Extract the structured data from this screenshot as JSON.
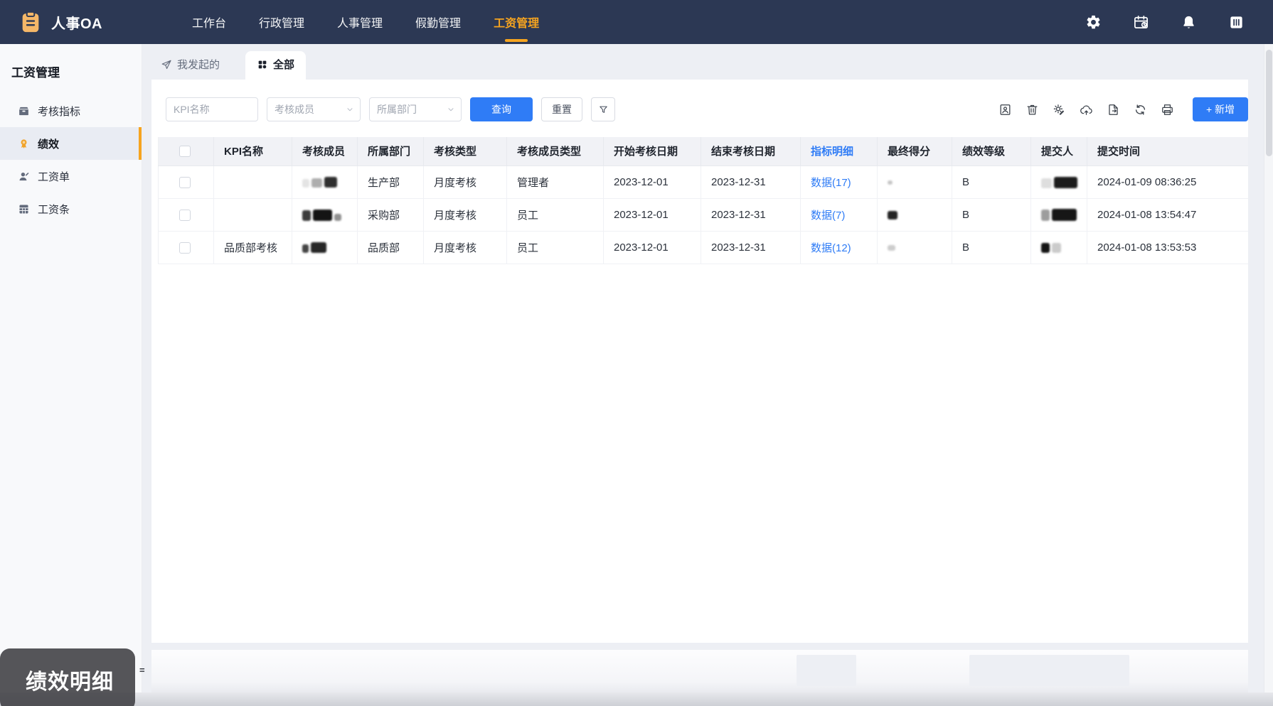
{
  "navbar": {
    "logo_text": "人事OA",
    "menu": [
      {
        "label": "工作台",
        "active": false
      },
      {
        "label": "行政管理",
        "active": false
      },
      {
        "label": "人事管理",
        "active": false
      },
      {
        "label": "假勤管理",
        "active": false
      },
      {
        "label": "工资管理",
        "active": true
      }
    ],
    "action_icons": [
      "gear",
      "calendar",
      "bell",
      "panel"
    ]
  },
  "sidebar": {
    "title": "工资管理",
    "items": [
      {
        "label": "考核指标",
        "icon": "archive-box",
        "active": false
      },
      {
        "label": "绩效",
        "icon": "medal",
        "active": true
      },
      {
        "label": "工资单",
        "icon": "user",
        "active": false
      },
      {
        "label": "工资条",
        "icon": "table",
        "active": false
      }
    ]
  },
  "tabs": [
    {
      "label": "我发起的",
      "icon": "send",
      "active": false
    },
    {
      "label": "全部",
      "icon": "grid",
      "active": true
    }
  ],
  "filters": {
    "kpi_placeholder": "KPI名称",
    "member_placeholder": "考核成员",
    "dept_placeholder": "所属部门",
    "search_label": "查询",
    "reset_label": "重置"
  },
  "toolbar": {
    "icons": [
      "id-card",
      "trash",
      "gear-edit",
      "cloud-upload",
      "file-export",
      "refresh",
      "printer"
    ],
    "add_label": "+ 新增"
  },
  "table": {
    "columns": [
      {
        "label": "KPI名称"
      },
      {
        "label": "考核成员"
      },
      {
        "label": "所属部门"
      },
      {
        "label": "考核类型"
      },
      {
        "label": "考核成员类型"
      },
      {
        "label": "开始考核日期"
      },
      {
        "label": "结束考核日期"
      },
      {
        "label": "指标明细",
        "highlighted": true
      },
      {
        "label": "最终得分"
      },
      {
        "label": "绩效等级"
      },
      {
        "label": "提交人"
      },
      {
        "label": "提交时间"
      }
    ],
    "rows": [
      {
        "kpi_name": "",
        "member": {
          "redacted": true,
          "variant": "member-a"
        },
        "dept": "生产部",
        "assess_type": "月度考核",
        "member_type": "管理者",
        "start_date": "2023-12-01",
        "end_date": "2023-12-31",
        "indicator_detail": "数据(17)",
        "score": {
          "redacted": true,
          "variant": "score-a"
        },
        "grade": "B",
        "submitter": {
          "redacted": true,
          "variant": "sub-a"
        },
        "submit_time": "2024-01-09 08:36:25"
      },
      {
        "kpi_name": "",
        "member": {
          "redacted": true,
          "variant": "member-b"
        },
        "dept": "采购部",
        "assess_type": "月度考核",
        "member_type": "员工",
        "start_date": "2023-12-01",
        "end_date": "2023-12-31",
        "indicator_detail": "数据(7)",
        "score": {
          "redacted": true,
          "variant": "score-b"
        },
        "grade": "B",
        "submitter": {
          "redacted": true,
          "variant": "sub-b"
        },
        "submit_time": "2024-01-08 13:54:47"
      },
      {
        "kpi_name": "品质部考核",
        "member": {
          "redacted": true,
          "variant": "member-c"
        },
        "dept": "品质部",
        "assess_type": "月度考核",
        "member_type": "员工",
        "start_date": "2023-12-01",
        "end_date": "2023-12-31",
        "indicator_detail": "数据(12)",
        "score": {
          "redacted": true,
          "variant": "score-c"
        },
        "grade": "B",
        "submitter": {
          "redacted": true,
          "variant": "sub-c"
        },
        "submit_time": "2024-01-08 13:53:53"
      }
    ]
  },
  "overlay": {
    "label": "绩效明细"
  },
  "footer": {
    "equals_mark": "="
  },
  "colors": {
    "navbar_bg": "#2c3854",
    "accent_orange": "#f6a41f",
    "primary_blue": "#2f7cf6",
    "link_blue": "#2f7cf6"
  }
}
